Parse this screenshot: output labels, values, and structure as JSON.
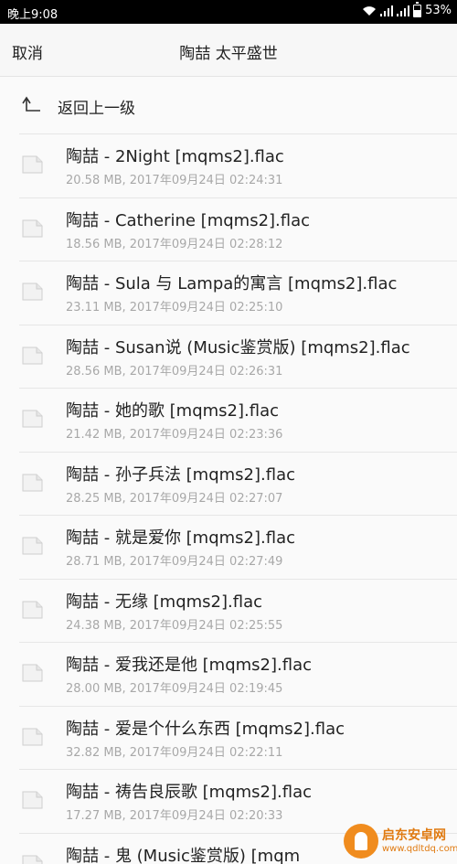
{
  "status_bar": {
    "time": "晚上9:08",
    "battery": "53%",
    "icons": [
      "wifi-icon",
      "signal-icon",
      "signal-icon",
      "battery-icon"
    ]
  },
  "header": {
    "cancel_label": "取消",
    "title": "陶喆 太平盛世"
  },
  "back": {
    "label": "返回上一级",
    "icon": "back-up-icon"
  },
  "files": [
    {
      "name": "陶喆 - 2Night [mqms2].flac",
      "meta": "20.58 MB, 2017年09月24日  02:24:31"
    },
    {
      "name": "陶喆 - Catherine [mqms2].flac",
      "meta": "18.56 MB, 2017年09月24日  02:28:12"
    },
    {
      "name": "陶喆 - Sula 与 Lampa的寓言 [mqms2].flac",
      "meta": "23.11 MB, 2017年09月24日  02:25:10"
    },
    {
      "name": "陶喆 - Susan说 (Music鉴赏版) [mqms2].flac",
      "meta": "28.56 MB, 2017年09月24日  02:26:31"
    },
    {
      "name": "陶喆 - 她的歌 [mqms2].flac",
      "meta": "21.42 MB, 2017年09月24日  02:23:36"
    },
    {
      "name": "陶喆 - 孙子兵法 [mqms2].flac",
      "meta": "28.25 MB, 2017年09月24日  02:27:07"
    },
    {
      "name": "陶喆 - 就是爱你 [mqms2].flac",
      "meta": "28.71 MB, 2017年09月24日  02:27:49"
    },
    {
      "name": "陶喆 - 无缘 [mqms2].flac",
      "meta": "24.38 MB, 2017年09月24日  02:25:55"
    },
    {
      "name": "陶喆 - 爱我还是他 [mqms2].flac",
      "meta": "28.00 MB, 2017年09月24日  02:19:45"
    },
    {
      "name": "陶喆 - 爱是个什么东西 [mqms2].flac",
      "meta": "32.82 MB, 2017年09月24日  02:22:11"
    },
    {
      "name": "陶喆 - 祷告良辰歌 [mqms2].flac",
      "meta": "17.27 MB, 2017年09月24日  02:20:33"
    },
    {
      "name": "陶喆 - 鬼 (Music鉴赏版) [mqm",
      "meta": ""
    }
  ],
  "watermark": {
    "text": "启东安卓网",
    "url": "www.qdltdq.com"
  }
}
